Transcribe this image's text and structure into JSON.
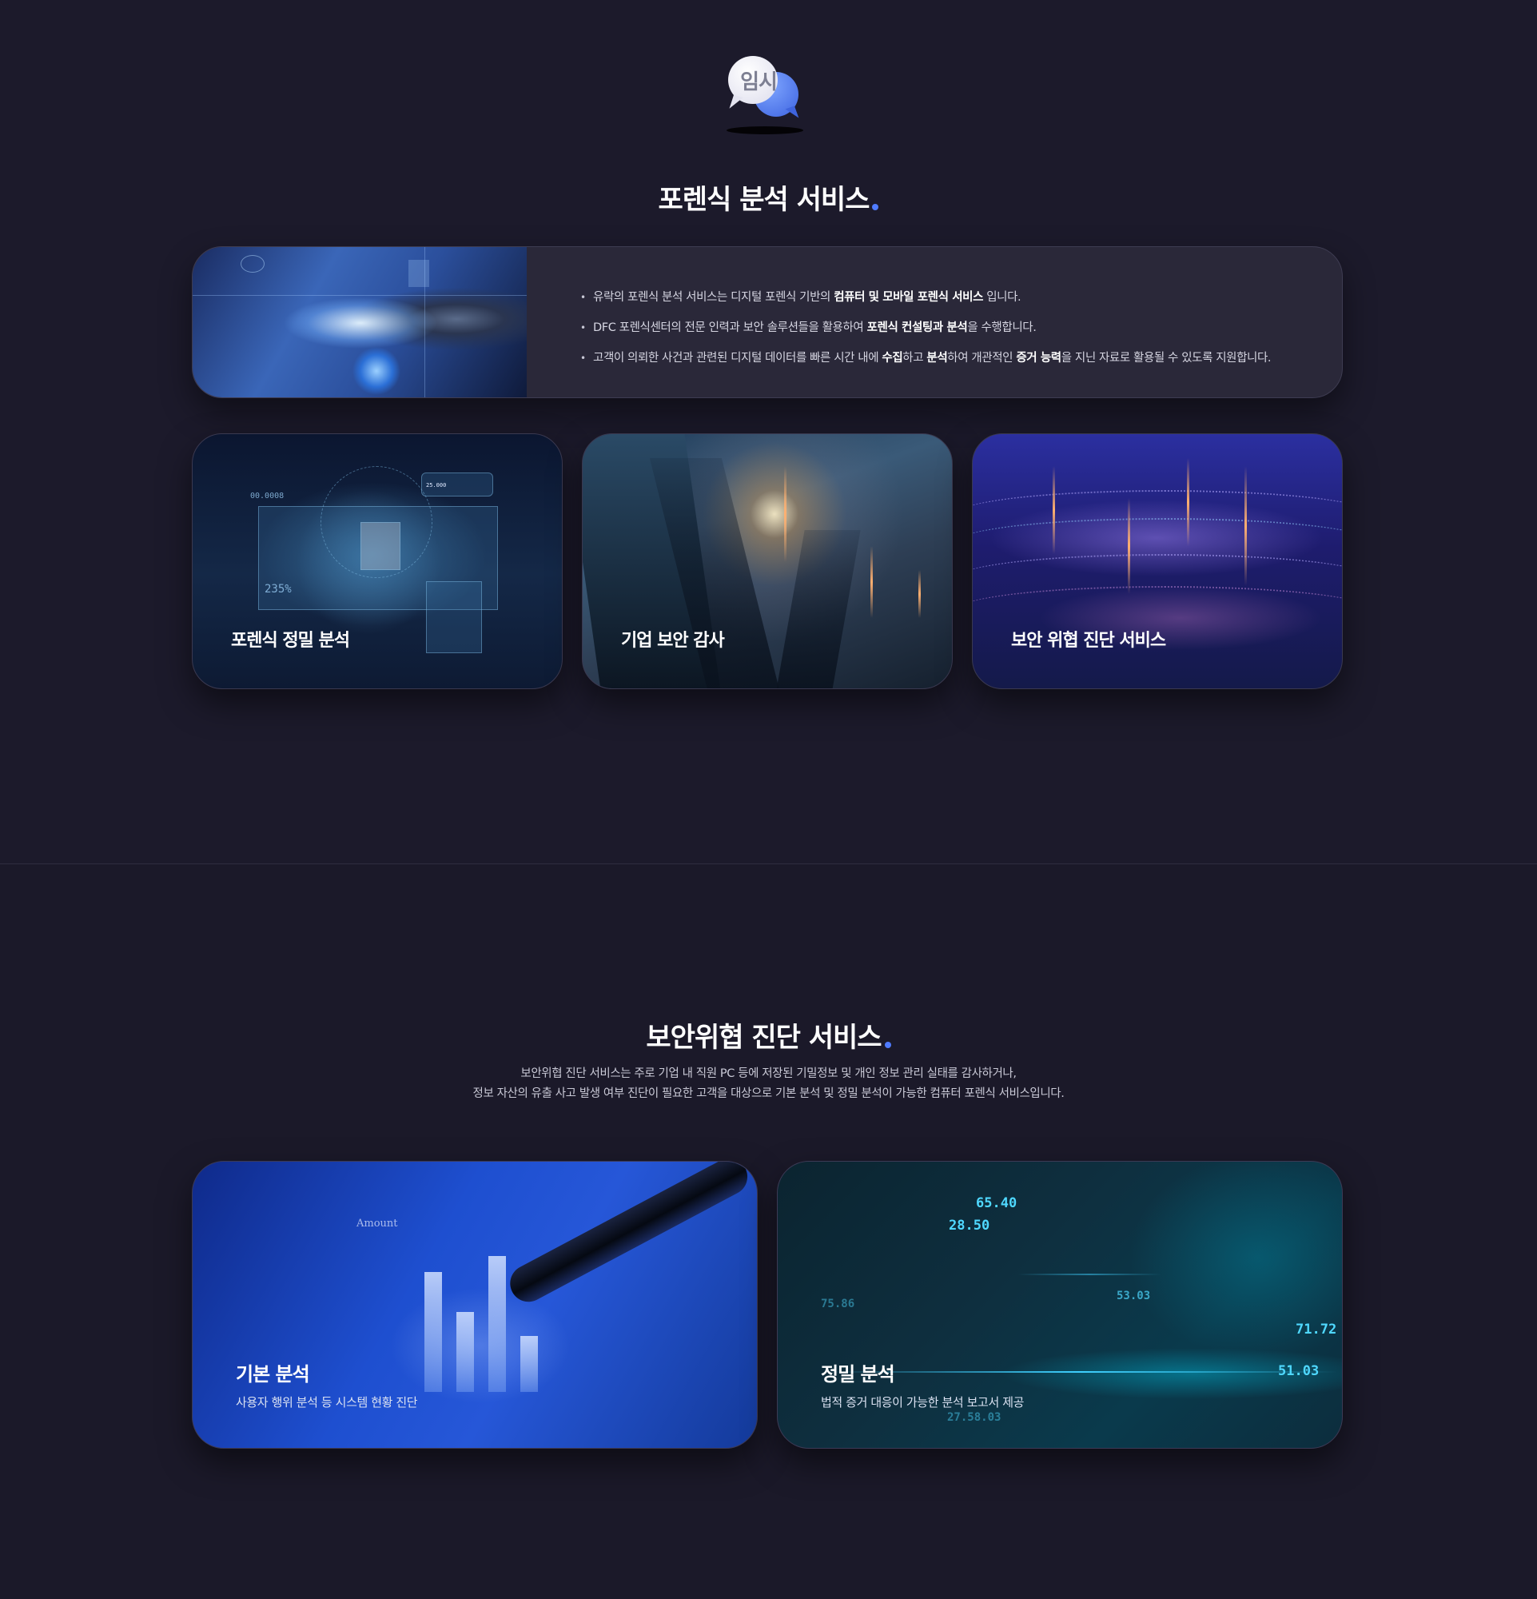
{
  "logo": {
    "text": "임시"
  },
  "section1": {
    "title": "포렌식 분석 서비스",
    "intro": [
      {
        "parts": [
          {
            "t": "유락의 포렌식 분석 서비스는 디지털 포렌식 기반의 "
          },
          {
            "t": "컴퓨터 및 모바일 포렌식 서비스",
            "b": true
          },
          {
            "t": " 입니다."
          }
        ]
      },
      {
        "parts": [
          {
            "t": "DFC 포렌식센터의 전문 인력과 보안 솔루션들을 활용하여 "
          },
          {
            "t": "포렌식 컨설팅과 분석",
            "b": true
          },
          {
            "t": "을 수행합니다."
          }
        ]
      },
      {
        "parts": [
          {
            "t": "고객이 의뢰한 사건과 관련된 디지털 데이터를 빠른 시간 내에 "
          },
          {
            "t": "수집",
            "b": true
          },
          {
            "t": "하고 "
          },
          {
            "t": "분석",
            "b": true
          },
          {
            "t": "하여 개관적인 "
          },
          {
            "t": "증거 능력",
            "b": true
          },
          {
            "t": "을 지닌 자료로 활용될 수 있도록 지원합니다."
          }
        ]
      }
    ],
    "cards": [
      {
        "label": "포렌식 정밀 분석",
        "deco1": "00.0008",
        "deco2": "235%",
        "deco3": "25.000"
      },
      {
        "label": "기업 보안 감사"
      },
      {
        "label": "보안 위협 진단 서비스"
      }
    ]
  },
  "section2": {
    "title": "보안위협 진단 서비스",
    "description": [
      "보안위협 진단 서비스는 주로 기업 내 직원 PC 등에 저장된 기밀정보 및 개인 정보 관리 실태를 감사하거나,",
      "정보 자산의 유출 사고 발생 여부 진단이 필요한 고객을 대상으로 기본 분석 및 정밀 분석이 가능한 컴퓨터 포렌식 서비스입니다."
    ],
    "cards": [
      {
        "title": "기본 분석",
        "subtitle": "사용자 행위 분석 등 시스템 현황 진단",
        "deco_label": "Amount"
      },
      {
        "title": "정밀 분석",
        "subtitle": "법적 증거 대응이 가능한 분석 보고서 제공",
        "numbers": [
          "65.40",
          "28.50",
          "75.86",
          "53.03",
          "71.72",
          "51.03",
          "27.58.03"
        ]
      }
    ]
  },
  "colors": {
    "background": "#1d1b2c",
    "accent_dot": "#4f7bff",
    "card": "#2a2839"
  }
}
